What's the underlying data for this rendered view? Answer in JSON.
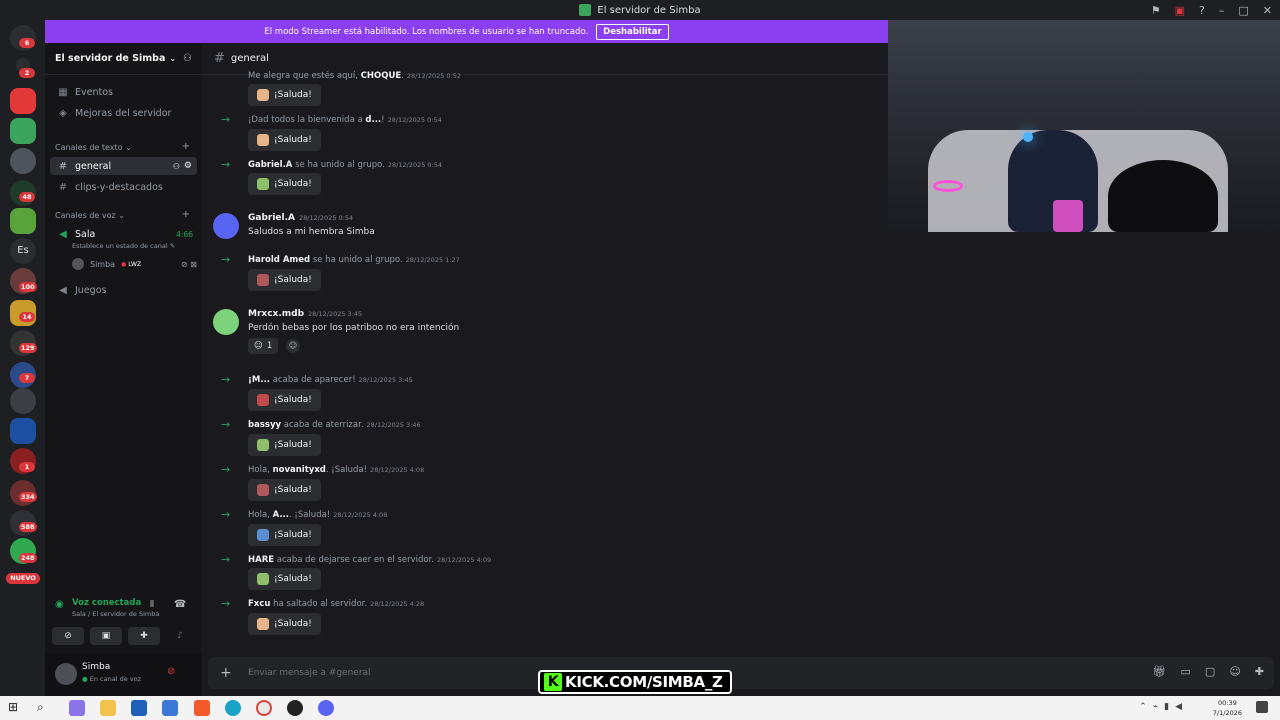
{
  "titlebar": {
    "title": "El servidor de Simba"
  },
  "banner": {
    "text": "El modo Streamer está habilitado. Los nombres de usuario se han truncado.",
    "button": "Deshabilitar"
  },
  "rail": {
    "badges": [
      "6",
      "2",
      "48",
      "100",
      "14",
      "129",
      "7",
      "1",
      "334",
      "588",
      "248"
    ],
    "es_label": "Es",
    "nuevo": "NUEVO"
  },
  "sidebar": {
    "server_name": "El servidor de Simba",
    "events": "Eventos",
    "boosts": "Mejoras del servidor",
    "text_category": "Canales de texto",
    "text_channels": [
      "general",
      "clips-y-destacados"
    ],
    "voice_category": "Canales de voz",
    "voice_channel": "Sala",
    "voice_time": "4:66",
    "voice_status": "Establece un estado de canal",
    "voice_user": "Simba",
    "live_badge": "LWZ",
    "juegos": "Juegos"
  },
  "voice_panel": {
    "title": "Voz conectada",
    "sub": "Sala / El servidor de Simba"
  },
  "user_panel": {
    "name": "Simba",
    "status": "En canal de voz"
  },
  "chat": {
    "channel": "general",
    "wave_label": "¡Saluda!",
    "composer_placeholder": "Enviar mensaje a #general",
    "system": [
      {
        "pre": "Me alegra que estés aquí, ",
        "name": "CHOQUE",
        "post": ".",
        "ts": "28/12/2025 0:52"
      },
      {
        "pre": "¡Dad todos la bienvenida a ",
        "name": "d...",
        "post": "!",
        "ts": "28/12/2025 0:54"
      },
      {
        "pre": "",
        "name": "Gabriel.A",
        "post": " se ha unido al grupo.",
        "ts": "28/12/2025 0:54"
      },
      {
        "pre": "",
        "name": "Harold Amed",
        "post": " se ha unido al grupo.",
        "ts": "28/12/2025 1:27"
      },
      {
        "pre": "",
        "name": "¡M...",
        "post": " acaba de aparecer!",
        "ts": "28/12/2025 3:45"
      },
      {
        "pre": "",
        "name": "bassyy",
        "post": " acaba de aterrizar.",
        "ts": "28/12/2025 3:46"
      },
      {
        "pre": "Hola, ",
        "name": "novanityxd",
        "post": ". ¡Saluda!",
        "ts": "28/12/2025 4:08"
      },
      {
        "pre": "Hola, ",
        "name": "A...",
        "post": ". ¡Saluda!",
        "ts": "28/12/2025 4:08"
      },
      {
        "pre": "",
        "name": "HARE",
        "post": " acaba de dejarse caer en el servidor.",
        "ts": "28/12/2025 4:09"
      },
      {
        "pre": "",
        "name": "Fxcu",
        "post": " ha saltado al servidor.",
        "ts": "28/12/2025 4:28"
      }
    ],
    "messages": [
      {
        "author": "Gabriel.A",
        "ts": "28/12/2025 0:54",
        "text": "Saludos a mi hembra Simba"
      },
      {
        "author": "Mrxcx.mdb",
        "ts": "28/12/2025 3:45",
        "text": "Perdón bebas por los patriboo no era intención",
        "reaction_count": "1"
      }
    ]
  },
  "overlay": {
    "kick_text": "KICK.COM/SIMBA_Z"
  },
  "taskbar": {
    "time": "00:39",
    "date": "7/1/2026"
  },
  "colors": {
    "accent": "#8c3ff0",
    "green": "#23a55a",
    "kick": "#53fc18"
  }
}
